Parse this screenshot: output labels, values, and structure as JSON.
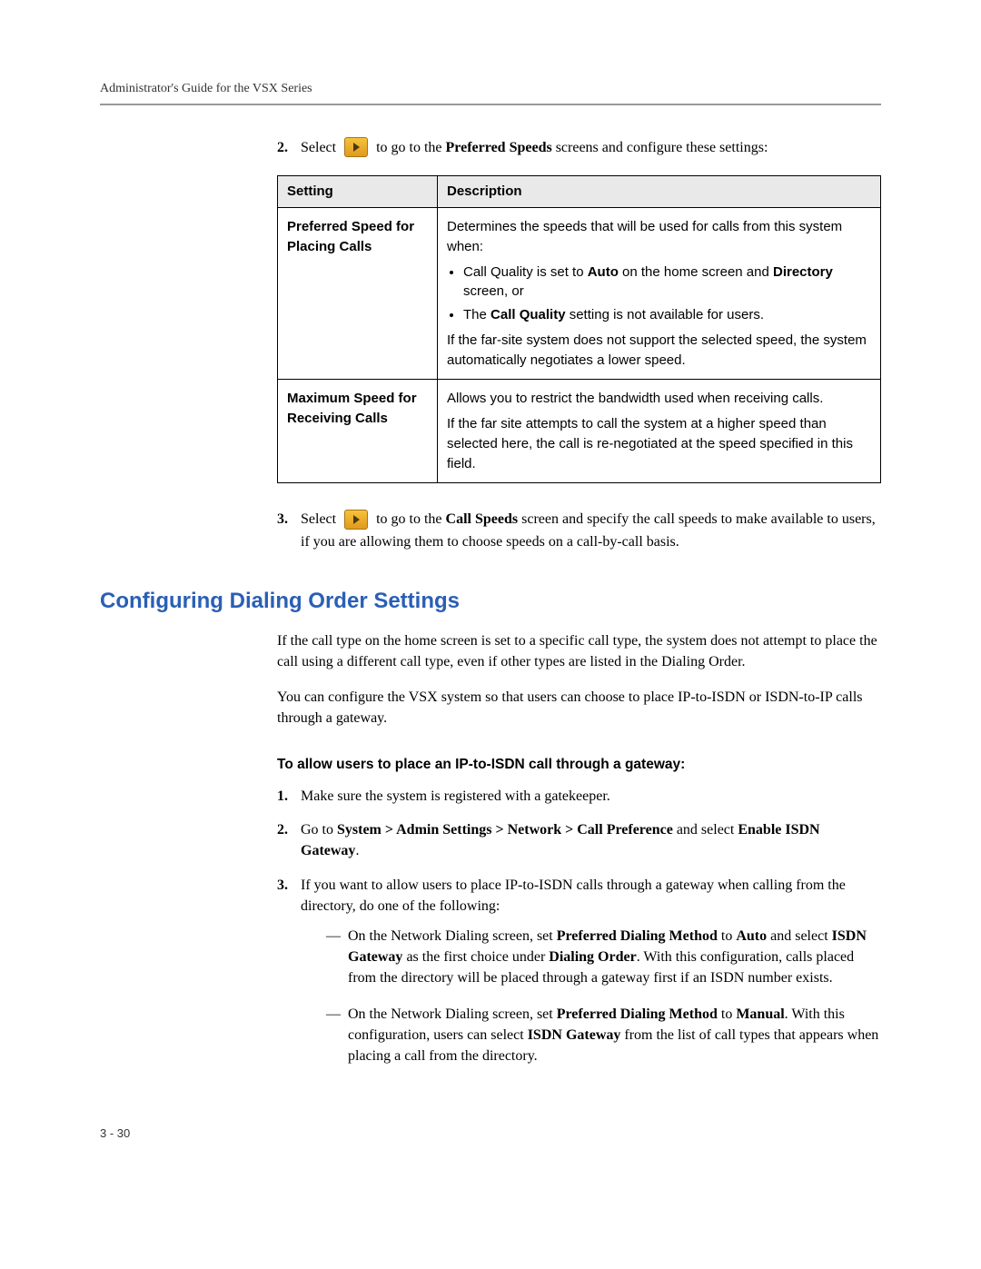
{
  "header": "Administrator's Guide for the VSX Series",
  "step2": {
    "num": "2.",
    "before": "Select",
    "after_a": " to go to the ",
    "bold_a": "Preferred Speeds",
    "after_b": " screens and configure these settings:"
  },
  "table": {
    "h1": "Setting",
    "h2": "Description",
    "r1": {
      "label": "Preferred Speed for Placing Calls",
      "lead": "Determines the speeds that will be used for calls from this system when:",
      "b1a": "Call Quality is set to ",
      "b1b": "Auto",
      "b1c": " on the home screen and ",
      "b1d": "Directory",
      "b1e": " screen, or",
      "b2a": "The ",
      "b2b": "Call Quality",
      "b2c": " setting is not available for users.",
      "tail": "If the far-site system does not support the selected speed, the system automatically negotiates a lower speed."
    },
    "r2": {
      "label": "Maximum Speed for Receiving Calls",
      "p1": "Allows you to restrict the bandwidth used when receiving calls.",
      "p2": "If the far site attempts to call the system at a higher speed than selected here, the call is re-negotiated at the speed specified in this field."
    }
  },
  "step3": {
    "num": "3.",
    "before": "Select",
    "after_a": " to go to the ",
    "bold_a": "Call Speeds",
    "after_b": " screen and specify the call speeds to make available to users, if you are allowing them to choose speeds on a call-by-call basis."
  },
  "section_heading": "Configuring Dialing Order Settings",
  "para1": "If the call type on the home screen is set to a specific call type, the system does not attempt to place the call using a different call type, even if other types are listed in the Dialing Order.",
  "para2": "You can configure the VSX system so that users can choose to place IP-to-ISDN or ISDN-to-IP calls through a gateway.",
  "subheading": "To allow users to place an IP-to-ISDN call through a gateway:",
  "proc": {
    "i1": {
      "n": "1.",
      "t": "Make sure the system is registered with a gatekeeper."
    },
    "i2": {
      "n": "2.",
      "a": "Go to ",
      "b": "System > Admin Settings > Network > Call Preference",
      "c": " and select ",
      "d": "Enable ISDN Gateway",
      "e": "."
    },
    "i3": {
      "n": "3.",
      "lead": "If you want to allow users to place IP-to-ISDN calls through a gateway when calling from the directory, do one of the following:",
      "d1": {
        "a": "On the Network Dialing screen, set ",
        "b": "Preferred Dialing Method",
        "c": " to ",
        "d": "Auto",
        "e": " and select ",
        "f": "ISDN Gateway",
        "g": " as the first choice under ",
        "h": "Dialing Order",
        "i": ". With this configuration, calls placed from the directory will be placed through a gateway first if an ISDN number exists."
      },
      "d2": {
        "a": "On the Network Dialing screen, set ",
        "b": "Preferred Dialing Method",
        "c": " to ",
        "d": "Manual",
        "e": ". With this configuration, users can select ",
        "f": "ISDN Gateway",
        "g": " from the list of call types that appears when placing a call from the directory."
      }
    }
  },
  "page_num": "3 - 30"
}
